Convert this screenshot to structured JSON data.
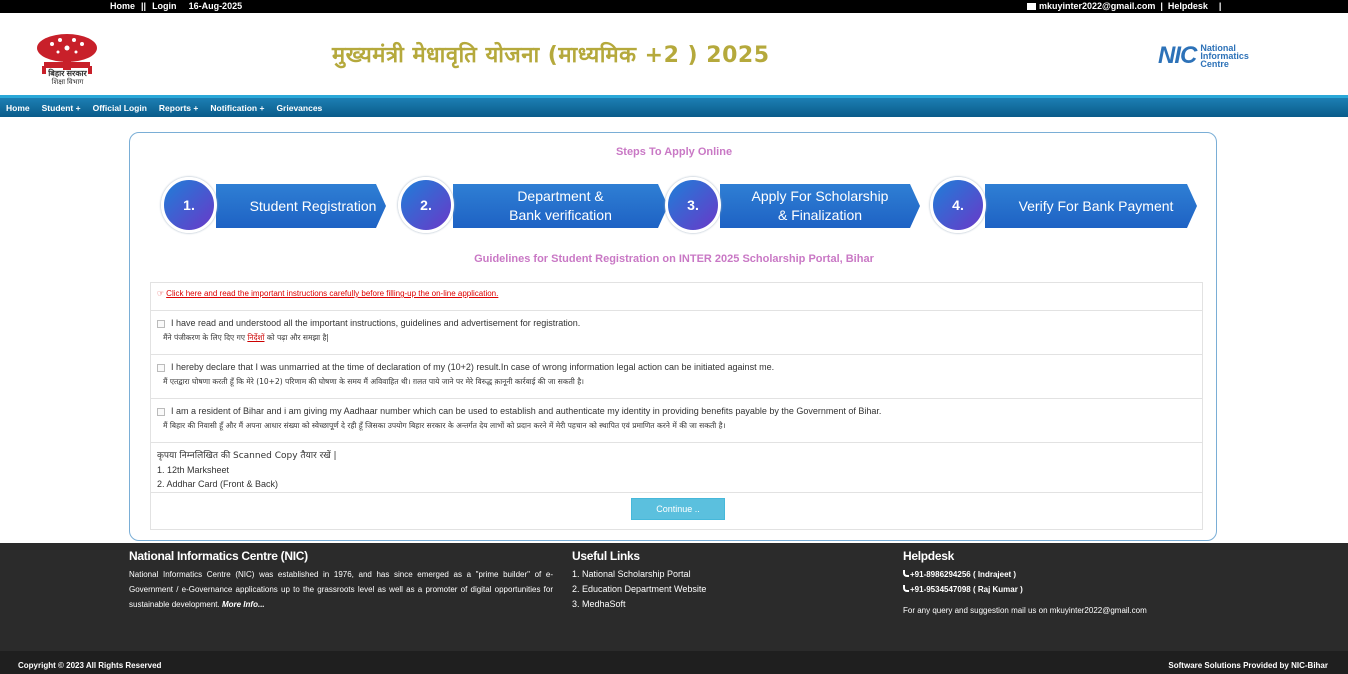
{
  "topbar": {
    "home": "Home",
    "sep": "||",
    "login": "Login",
    "date": "16-Aug-2025",
    "email": "mkuyinter2022@gmail.com",
    "divider": "|",
    "helpdesk": "Helpdesk",
    "tail": "|"
  },
  "header": {
    "emblem_caption_1": "बिहार सरकार",
    "emblem_caption_2": "शिक्षा विभाग",
    "title": "मुख्यमंत्री  मेधावृति योजना (माध्यमिक +2 ) 2025",
    "nic_letters": "NIC",
    "nic_text": [
      "National",
      "Informatics",
      "Centre"
    ]
  },
  "nav": [
    "Home",
    "Student +",
    "Official Login",
    "Reports +",
    "Notification +",
    "Grievances"
  ],
  "steps": {
    "title": "Steps To Apply Online",
    "items": [
      {
        "num": "1.",
        "label": "Student Registration"
      },
      {
        "num": "2.",
        "label": "Department &\nBank verification"
      },
      {
        "num": "3.",
        "label": "Apply For Scholarship\n& Finalization"
      },
      {
        "num": "4.",
        "label": "Verify For Bank Payment"
      }
    ]
  },
  "guidelines": {
    "title": "Guidelines for Student Registration on INTER 2025 Scholarship Portal, Bihar",
    "instructions_link": "Click here and read the important instructions carefully before filling-up the on-line application.",
    "decl1_en": "I have read and understood all the important instructions, guidelines and advertisement for registration.",
    "decl1_hi_a": "मैंने पंजीकरण के लिए दिए गए ",
    "decl1_hi_link": "निर्देशों",
    "decl1_hi_b": " को पढ़ा और समझा है|",
    "decl2_en": "I hereby declare that I was unmarried at the time of declaration of my (10+2) result.In case of wrong information legal action can be initiated against me.",
    "decl2_hi": "मैं एतद्वारा घोषणा करती हूँ कि मेरे (10+2) परिणाम की घोषणा के समय मैं अविवाहित थी। ग़लत पाये जाने पर मेरे विरुद्ध क़ानूनी कार्रवाई की जा सकती है।",
    "decl3_en": "I am a resident of Bihar and i am giving my Aadhaar number which can be used to establish and authenticate my identity in providing benefits payable by the Government of Bihar.",
    "decl3_hi": "मैं बिहार की निवासी हूँ और मैं अपना आधार संख्या को स्वेच्छापूर्ण दे रही हूँ जिसका उपयोग बिहार सरकार के अन्तर्गत देय लाभों को प्रदान करने में मेरी पहचान को स्थापित एवं प्रमाणित करने में की जा सकती है।",
    "docs_title": "कृपया निम्नलिखित की Scanned Copy तैयार रखें |",
    "docs": [
      "1. 12th Marksheet",
      "2. Addhar Card (Front & Back)"
    ],
    "continue": "Continue .."
  },
  "footer": {
    "nic_title": "National Informatics Centre (NIC)",
    "nic_desc": "National Informatics Centre (NIC) was established in 1976, and has since emerged as a \"prime builder\" of e-Government / e-Governance applications up to the grassroots level as well as a promoter of digital opportunities for sustainable development.",
    "more": "More Info...",
    "links_title": "Useful Links",
    "links": [
      "1. National Scholarship Portal",
      "2. Education Department Website",
      "3. MedhaSoft"
    ],
    "help_title": "Helpdesk",
    "phone1": "+91-8986294256 ( Indrajeet )",
    "phone2": "+91-9534547098 ( Raj Kumar )",
    "query": "For any query and suggestion mail us on mkuyinter2022@gmail.com"
  },
  "bottom": {
    "copyright": "Copyright © 2023 All Rights Reserved",
    "provided": "Software Solutions Provided by NIC-Bihar"
  }
}
